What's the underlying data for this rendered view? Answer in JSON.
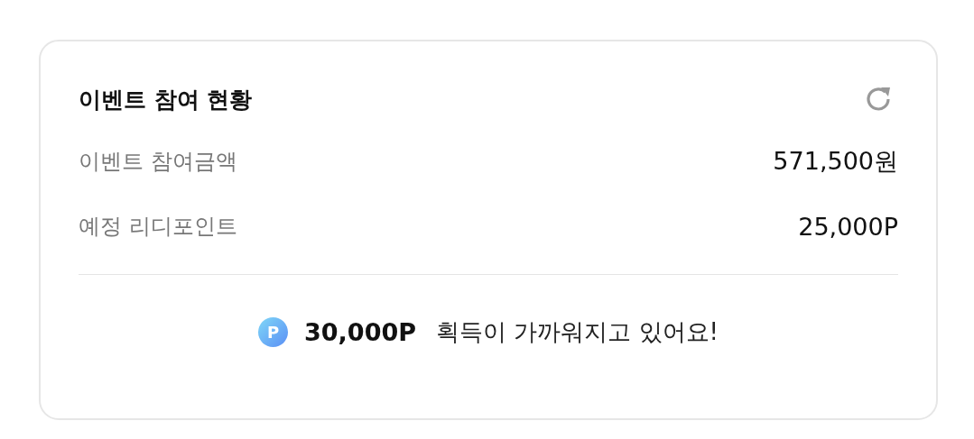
{
  "card": {
    "title": "이벤트 참여 현황",
    "rows": [
      {
        "label": "이벤트 참여금액",
        "value": "571,500원"
      },
      {
        "label": "예정 리디포인트",
        "value": "25,000P"
      }
    ],
    "footer": {
      "coin": "P",
      "amount": "30,000P",
      "message": "획득이 가까워지고 있어요!"
    }
  }
}
